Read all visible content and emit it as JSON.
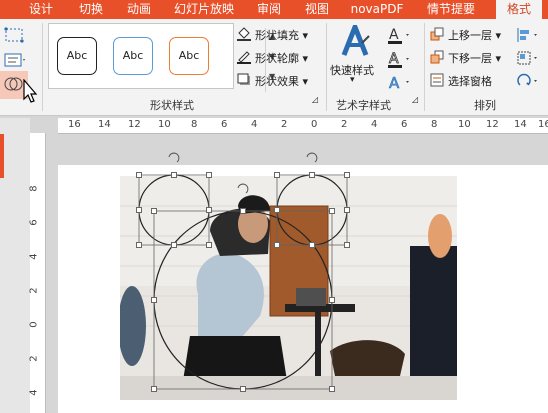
{
  "tabs": [
    "设计",
    "切换",
    "动画",
    "幻灯片放映",
    "审阅",
    "视图",
    "novaPDF",
    "情节提要",
    "格式"
  ],
  "active_tab": "格式",
  "styles": {
    "gallery": [
      "Abc",
      "Abc",
      "Abc"
    ],
    "fill": "形状填充",
    "outline": "形状轮廓",
    "effect": "形状效果",
    "group_label": "形状样式"
  },
  "art": {
    "quick": "快速样式",
    "group_label": "艺术字样式"
  },
  "arrange": {
    "forward": "上移一层",
    "backward": "下移一层",
    "pane": "选择窗格",
    "group_label": "排列"
  },
  "ruler_h": [
    "16",
    "14",
    "12",
    "10",
    "8",
    "6",
    "4",
    "2",
    "0",
    "2",
    "4",
    "6",
    "8",
    "10",
    "12",
    "14",
    "16"
  ],
  "ruler_v": [
    "8",
    "6",
    "4",
    "2",
    "0",
    "2",
    "4"
  ],
  "colors": {
    "brand": "#e8502a",
    "accent": "#d24726"
  }
}
